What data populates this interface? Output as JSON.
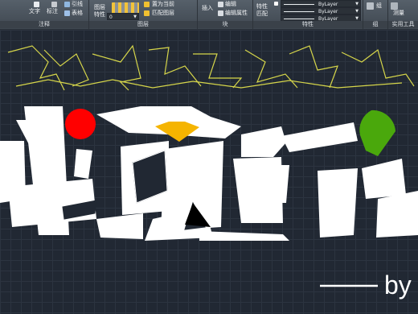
{
  "ribbon": {
    "groups": {
      "annotation": {
        "title": "注释",
        "text_label": "文字",
        "mark_label": "标注",
        "leader_label": "引线",
        "table_label": "表格"
      },
      "layers": {
        "title": "图层",
        "layer_props_label": "图层\n特性",
        "set_current_label": "置为当前",
        "match_layer_label": "匹配图层",
        "layer_combo": "0"
      },
      "block": {
        "title": "块",
        "insert_label": "插入",
        "edit_label": "编辑",
        "edit_attr_label": "编辑属性"
      },
      "properties": {
        "title": "特性",
        "match_label": "特性\n匹配",
        "bylayer1": "ByLayer",
        "bylayer2": "ByLayer",
        "bylayer3": "ByLayer"
      },
      "groups": {
        "title": "组",
        "group_label": "组"
      },
      "utilities": {
        "title": "实用工具",
        "measure_label": "测量"
      }
    }
  },
  "drawing": {
    "signature_text": "by",
    "colors": {
      "background": "#212833",
      "yellow_lines": "#d6d64a",
      "red_circle": "#ff0000",
      "green_shape": "#4aa80c",
      "gem": "#f5b400",
      "strokes": "#ffffff"
    }
  }
}
